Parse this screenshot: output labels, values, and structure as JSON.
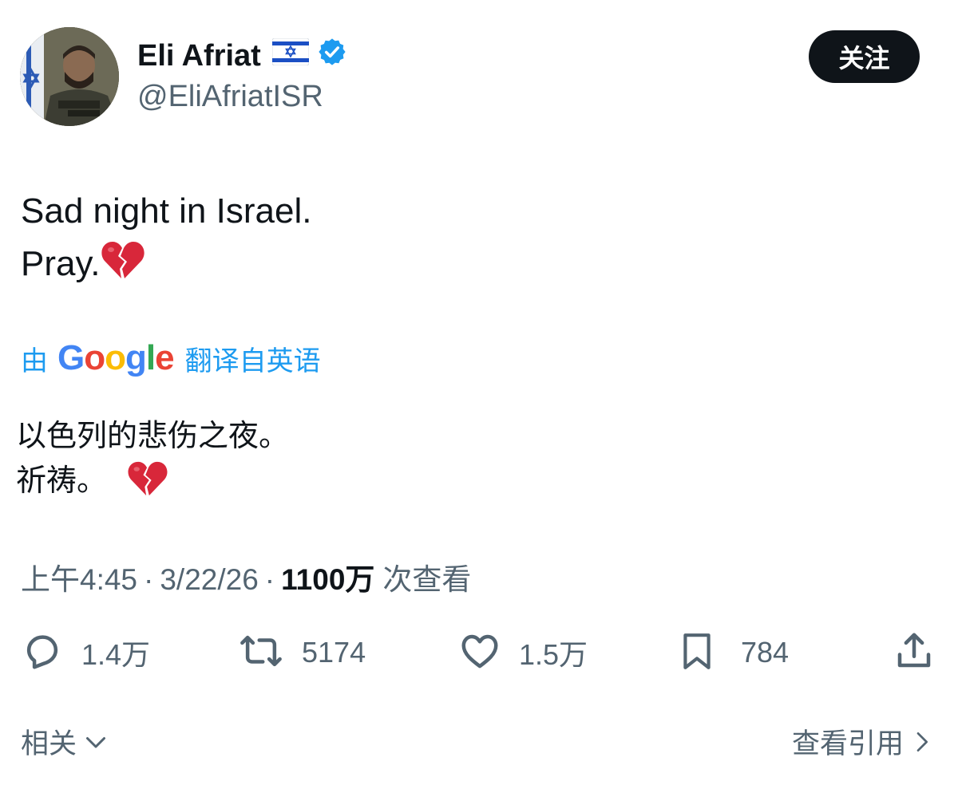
{
  "author": {
    "display_name": "Eli Afriat",
    "handle": "@EliAfriatISR",
    "flag_icon": "israel-flag-icon",
    "verified_icon": "verified-badge-icon"
  },
  "follow_button": {
    "label": "关注"
  },
  "tweet": {
    "lines": [
      "Sad night in Israel.",
      "Pray."
    ]
  },
  "translation": {
    "prefix": "由",
    "provider_letters": [
      "G",
      "o",
      "o",
      "g",
      "l",
      "e"
    ],
    "provider_colors": [
      "#4285F4",
      "#EA4335",
      "#FBBC05",
      "#4285F4",
      "#34A853",
      "#EA4335"
    ],
    "suffix": "翻译自英语",
    "lines": [
      "以色列的悲伤之夜。",
      "祈祷。"
    ]
  },
  "meta": {
    "time": "上午4:45",
    "separator": "·",
    "date": "3/22/26",
    "views_count": "1100万",
    "views_label": "次查看"
  },
  "actions": {
    "reply_count": "1.4万",
    "retweet_count": "5174",
    "like_count": "1.5万",
    "bookmark_count": "784"
  },
  "footer": {
    "related_label": "相关",
    "view_quotes_label": "查看引用"
  },
  "colors": {
    "text": "#0f1419",
    "muted": "#536471",
    "link": "#1d9bf0",
    "verified": "#1d9bf0",
    "heart_red": "#d8273a"
  }
}
